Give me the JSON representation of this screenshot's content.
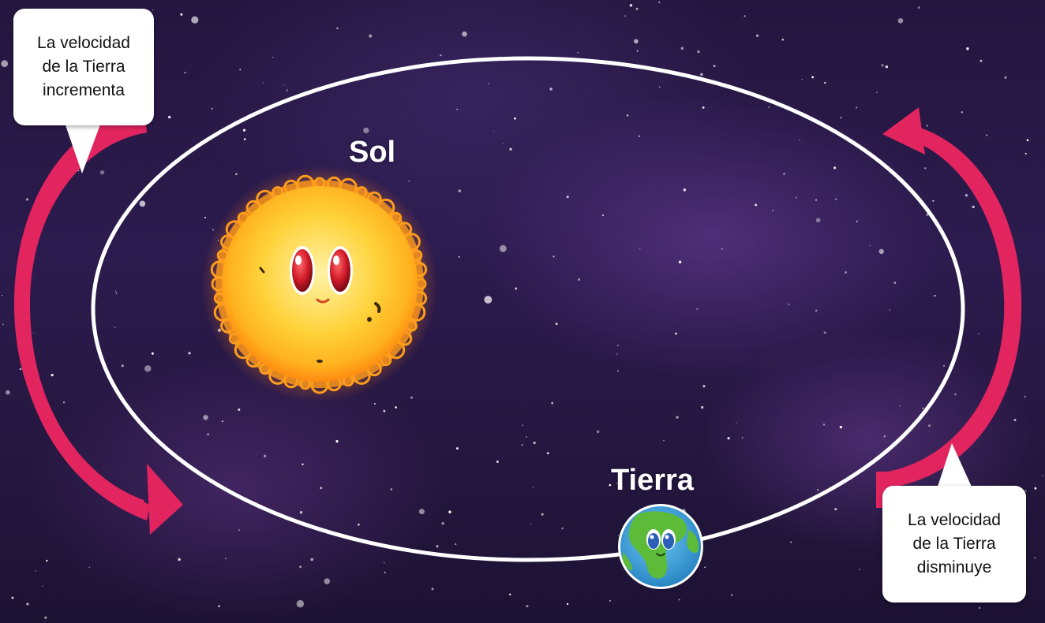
{
  "labels": {
    "sun": "Sol",
    "earth": "Tierra"
  },
  "callouts": {
    "left": {
      "lines": [
        "La velocidad",
        "de la Tierra",
        "incrementa"
      ]
    },
    "right": {
      "lines": [
        "La velocidad",
        "de la Tierra",
        "disminuye"
      ]
    }
  },
  "colors": {
    "orbit": "#ffffff",
    "arrow": "#e2245f",
    "sun_core": "#ffd23a",
    "sun_glow": "#ff9a1a",
    "earth_ocean": "#3a9fd8",
    "earth_land": "#5dbb3a",
    "eyes": "#d11a2a"
  },
  "icons": {
    "sun": "cartoon-sun-icon",
    "earth": "cartoon-earth-icon",
    "arrow_left": "curved-arrow-down-icon",
    "arrow_right": "curved-arrow-up-icon"
  }
}
